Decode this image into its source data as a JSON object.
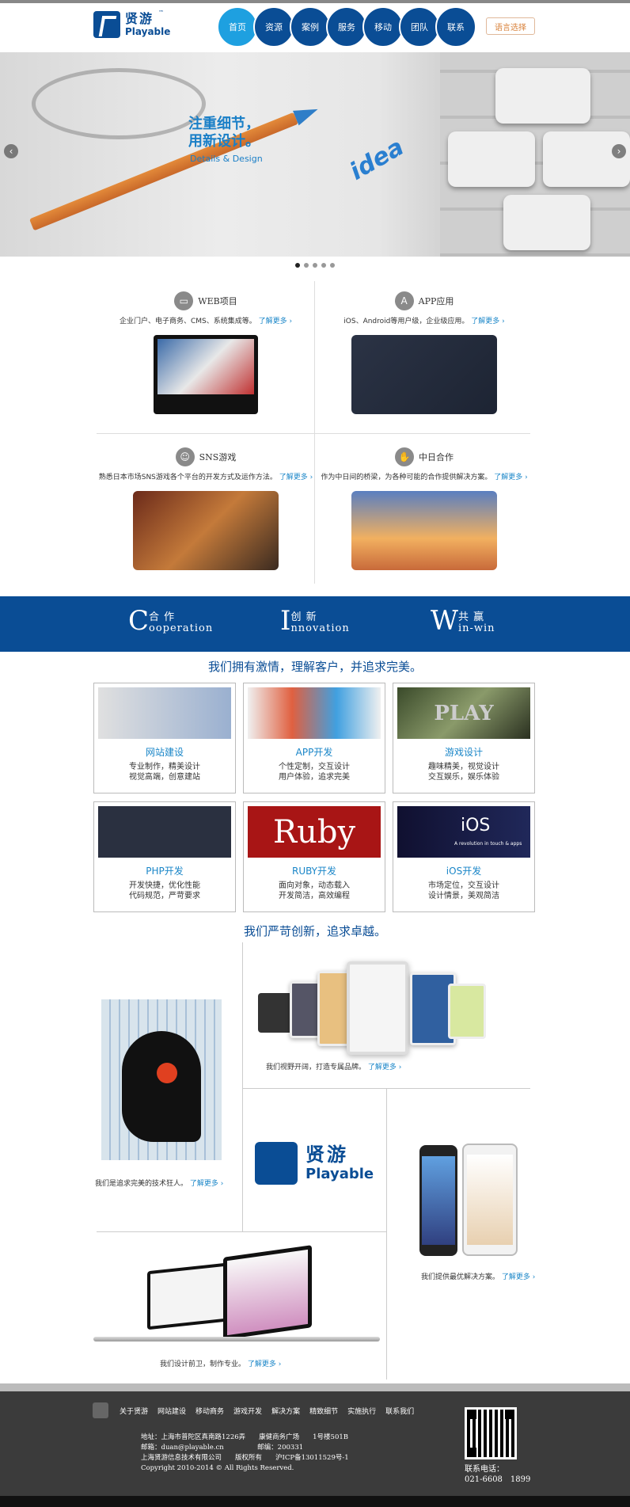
{
  "brand": {
    "name_cn": "贤游",
    "name_en": "Playable",
    "tm": "™"
  },
  "nav": {
    "items": [
      "首页",
      "资源",
      "案例",
      "服务",
      "移动",
      "团队",
      "联系"
    ],
    "lang": "语言选择"
  },
  "banner": {
    "slogan_line1": "注重细节，",
    "slogan_line2": "用新设计。",
    "slogan_en": "Details & Design",
    "idea_text": "idea",
    "prev": "‹",
    "next": "›"
  },
  "services": [
    {
      "title": "WEB项目",
      "desc": "企业门户、电子商务、CMS、系统集成等。",
      "more": "了解更多 ›"
    },
    {
      "title": "APP应用",
      "desc": "iOS、Android等用户级，企业级应用。",
      "more": "了解更多 ›"
    },
    {
      "title": "SNS游戏",
      "desc": "熟悉日本市场SNS游戏各个平台的开发方式及运作方法。",
      "more": "了解更多 ›"
    },
    {
      "title": "中日合作",
      "desc": "作为中日间的桥梁，为各种可能的合作提供解决方案。",
      "more": "了解更多 ›"
    }
  ],
  "mottos": [
    {
      "big": "C",
      "cn": "合 作",
      "en": "ooperation"
    },
    {
      "big": "I",
      "cn": "创 新",
      "en": "nnovation"
    },
    {
      "big": "W",
      "cn": "共 赢",
      "en": "in-win"
    }
  ],
  "section1_title": "我们拥有激情，理解客户，并追求完美。",
  "cards": [
    {
      "title": "网站建设",
      "line1": "专业制作，精美设计",
      "line2": "视觉高端，创意建站"
    },
    {
      "title": "APP开发",
      "line1": "个性定制，交互设计",
      "line2": "用户体验，追求完美"
    },
    {
      "title": "游戏设计",
      "line1": "趣味精美，视觉设计",
      "line2": "交互娱乐，娱乐体验"
    },
    {
      "title": "PHP开发",
      "line1": "开发快捷，优化性能",
      "line2": "代码规范，严苛要求"
    },
    {
      "title": "RUBY开发",
      "line1": "面向对象，动态载入",
      "line2": "开发简洁，高效编程"
    },
    {
      "title": "iOS开发",
      "line1": "市场定位，交互设计",
      "line2": "设计情景，美观简洁"
    }
  ],
  "card_images": {
    "play": "PLAY",
    "ruby": "Ruby",
    "ios": "iOS",
    "ios_sub": "A revolution in touch & apps"
  },
  "section2_title": "我们严苛创新，追求卓越。",
  "showcase": {
    "tech": "我们是追求完美的技术狂人。",
    "tablets": "我们视野开阔，打造专属品牌。",
    "phones": "我们提供最优解决方案。",
    "laptops": "我们设计前卫，制作专业。",
    "more": "了解更多 ›"
  },
  "footer": {
    "nav": [
      "关于贤游",
      "网站建设",
      "移动商务",
      "游戏开发",
      "解决方案",
      "精致细节",
      "实施执行",
      "联系我们"
    ],
    "address": "地址：上海市普陀区真南路1226弄　　康健商务广场　　1号楼501B",
    "email": "邮箱：duan@playable.cn　　　　　邮编：200331",
    "company": "上海贤游信息技术有限公司　　版权所有　　沪ICP备13011529号-1",
    "copyright": "Copyright 2010-2014 © All Rights Reserved.",
    "tel_label": "联系电话：",
    "tel": "021-6608　1899"
  }
}
